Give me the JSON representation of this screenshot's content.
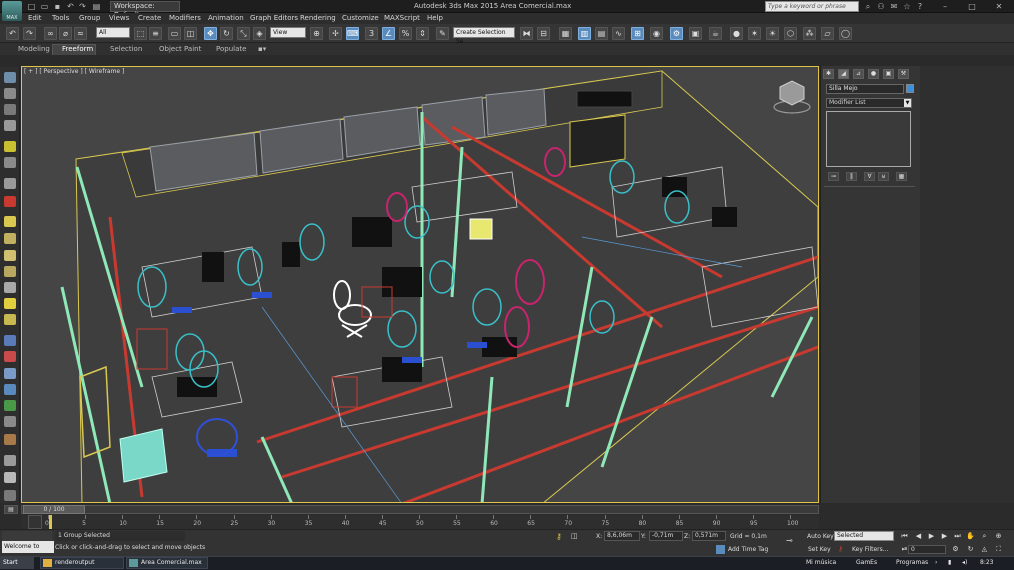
{
  "title_bar": {
    "app_title": "Autodesk 3ds Max 2015    Area Comercial.max",
    "workspace": "Workspace: Default",
    "search_placeholder": "Type a keyword or phrase"
  },
  "menu": [
    "Edit",
    "Tools",
    "Group",
    "Views",
    "Create",
    "Modifiers",
    "Animation",
    "Graph Editors",
    "Rendering",
    "Customize",
    "MAXScript",
    "Help"
  ],
  "toolbar": {
    "selection_filter": "All",
    "ref_coord": "View",
    "named_selection": "Create Selection Se"
  },
  "ribbon": {
    "tabs": [
      "Modeling",
      "Freeform",
      "Selection",
      "Object Paint",
      "Populate"
    ],
    "active_tab": "Freeform"
  },
  "viewport": {
    "label": "[ + ] [ Perspective ] [ Wireframe ]"
  },
  "command_panel": {
    "object_name": "Silla Mejo",
    "object_color": "#3c8fd8",
    "modifier_list": "Modifier List"
  },
  "time_slider": {
    "position": "0 / 100",
    "ticks": [
      "0",
      "5",
      "10",
      "15",
      "20",
      "25",
      "30",
      "35",
      "40",
      "45",
      "50",
      "55",
      "60",
      "65",
      "70",
      "75",
      "80",
      "85",
      "90",
      "95",
      "100"
    ]
  },
  "status": {
    "selection": "1 Group Selected",
    "prompt": "Click or click-and-drag to select and move objects",
    "maxscript": "Welcome to",
    "x_label": "X:",
    "x_value": "8,6,06m",
    "y_label": "Y:",
    "y_value": "-0,71m",
    "z_label": "Z:",
    "z_value": "0,571m",
    "grid": "Grid = 0,1m",
    "add_time_tag": "Add Time Tag",
    "auto_key": "Auto Key",
    "set_key": "Set Key",
    "key_mode": "Selected",
    "key_filters": "Key Filters...",
    "frame": "0"
  },
  "taskbar": {
    "start": "Start",
    "items": [
      "renderoutput",
      "Area Comercial.max ..."
    ],
    "tray": [
      "Mi música",
      "GamEs",
      "Programas"
    ],
    "clock": "8:23"
  },
  "colors": {
    "viewport_bg": "#454545",
    "active_border": "#e0c34a",
    "accent_blue": "#5a8bbd",
    "wire_red": "#c83a30",
    "wire_green": "#8ee8b8",
    "wire_cyan": "#39c0c8",
    "wire_magenta": "#c8246e",
    "wire_yellow": "#d8c850"
  }
}
